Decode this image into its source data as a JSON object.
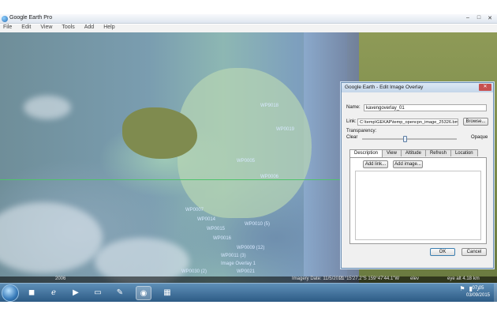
{
  "window": {
    "title": "Google Earth Pro",
    "controls": [
      "–",
      "□",
      "✕"
    ]
  },
  "menu": [
    "File",
    "Edit",
    "View",
    "Tools",
    "Add",
    "Help"
  ],
  "map_labels": [
    "WP9018",
    "WP0019",
    "WP0005",
    "WP0006",
    "WP0007",
    "WP0014",
    "WP0015",
    "WP0016",
    "WP0010 (5)",
    "WP0009 (12)",
    "WP0011 (3)",
    "Image Overlay 1",
    "WP0021",
    "WP0030 (2)"
  ],
  "statusbar": {
    "year": "2006",
    "imagery_date": "Imagery Date: 11/5/2011",
    "coords": "21°15'27.2\"S 159°47'44.1\"W",
    "elev": "elev",
    "eye_alt": "eye alt 4.18 km"
  },
  "dialog": {
    "title": "Google Earth - Edit Image Overlay",
    "name_label": "Name:",
    "name_value": "kavengoverlay_01",
    "link_label": "Link:",
    "link_value": "C:\\temp\\GEKAP\\temp_opencpn_image_25326.bmp",
    "browse": "Browse...",
    "transparency_label": "Transparency:",
    "clear": "Clear",
    "opaque": "Opaque",
    "transparency_value": 0.45,
    "tabs": [
      "Description",
      "View",
      "Altitude",
      "Refresh",
      "Location"
    ],
    "active_tab": "Description",
    "add_link": "Add link...",
    "add_image": "Add image...",
    "ok": "OK",
    "cancel": "Cancel"
  },
  "taskbar": {
    "apps": [
      "explorer-icon",
      "ie-icon",
      "media-icon",
      "folder-icon",
      "ie-icon",
      "notepad-icon",
      "google-earth-icon",
      "opencpn-icon"
    ],
    "tray_icons": [
      "flag-icon",
      "network-icon",
      "volume-icon"
    ],
    "time": "07:05",
    "date": "03/09/2015"
  },
  "colors": {
    "taskbar": "#2d5b85",
    "dialog_border": "#6d8fb3",
    "green_line": "#4fc36a"
  }
}
